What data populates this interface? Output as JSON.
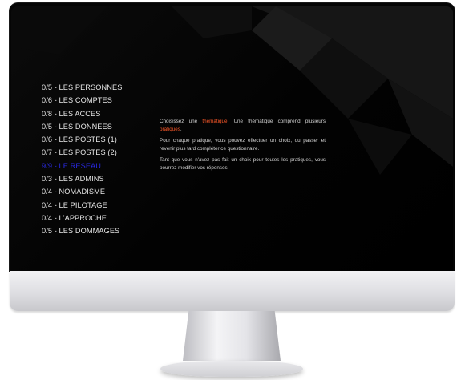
{
  "menu": {
    "items": [
      {
        "label": "0/5 - LES PERSONNES",
        "active": false
      },
      {
        "label": "0/6 - LES COMPTES",
        "active": false
      },
      {
        "label": "0/8 - LES ACCES",
        "active": false
      },
      {
        "label": "0/5 - LES DONNEES",
        "active": false
      },
      {
        "label": "0/6 - LES POSTES (1)",
        "active": false
      },
      {
        "label": "0/7 - LES POSTES (2)",
        "active": false
      },
      {
        "label": "9/9 - LE RESEAU",
        "active": true
      },
      {
        "label": "0/3 - LES ADMINS",
        "active": false
      },
      {
        "label": "0/4 - NOMADISME",
        "active": false
      },
      {
        "label": "0/4 - LE PILOTAGE",
        "active": false
      },
      {
        "label": "0/4 - L'APPROCHE",
        "active": false
      },
      {
        "label": "0/5 - LES DOMMAGES",
        "active": false
      }
    ]
  },
  "intro": {
    "p1_a": "Choisissez une",
    "p1_hl1": "thématique",
    "p1_b": ". Une thématique comprend plusieurs",
    "p1_hl2": "pratiques",
    "p1_c": ".",
    "p2": "Pour chaque pratique, vous pouvez effectuer un choix, ou passer et revenir plus tard compléter ce questionnaire.",
    "p3": "Tant que vous n'avez pas fait un choix pour toutes les pratiques, vous pourrez modifier vos réponses."
  },
  "colors": {
    "active_item": "#2a2ae8",
    "highlight": "#ff5a2a",
    "screen_bg": "#000000",
    "menu_text": "#e6e6e6"
  }
}
